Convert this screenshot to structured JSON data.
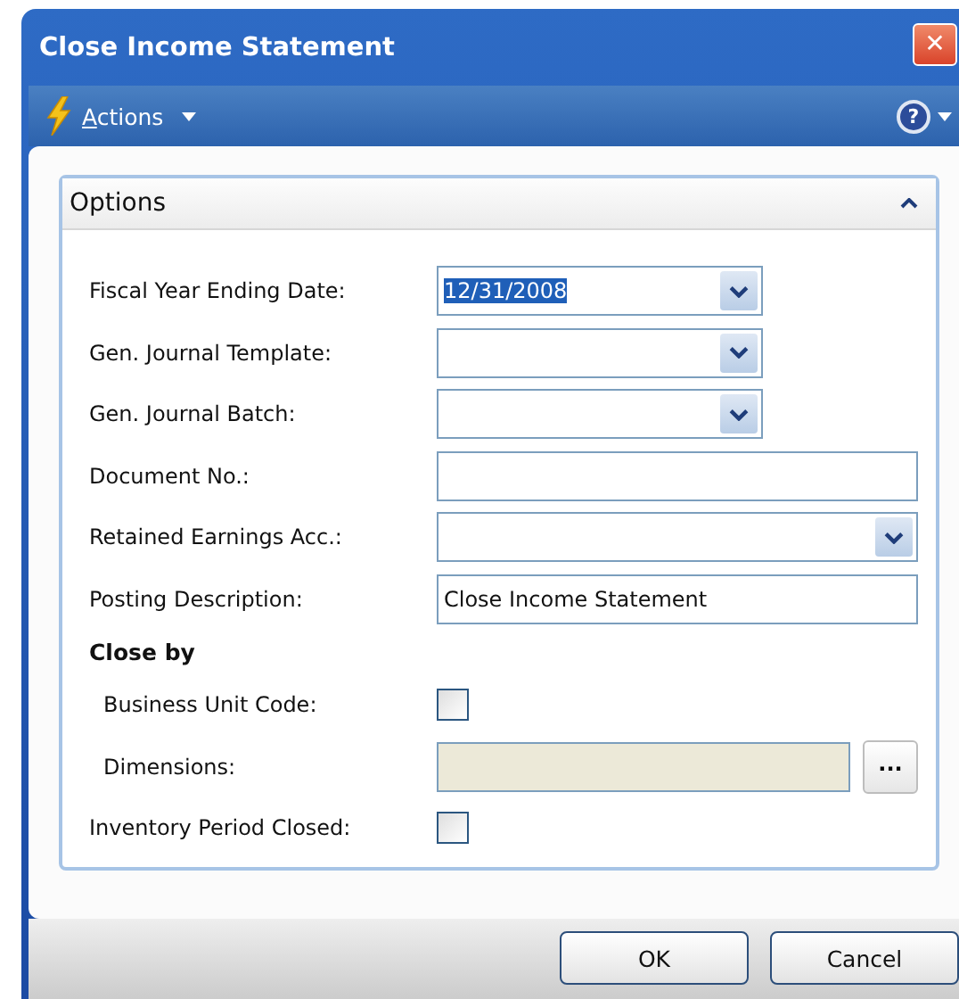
{
  "window": {
    "title": "Close Income Statement",
    "close": "✕"
  },
  "toolbar": {
    "actions": {
      "label": "Actions"
    },
    "help": "?"
  },
  "options": {
    "title": "Options",
    "expanded": true,
    "items": [
      {
        "kind": "dropdown",
        "label": "Fiscal Year Ending Date:",
        "value": "12/31/2008",
        "value_selected": true,
        "wide": false
      },
      {
        "kind": "dropdown",
        "label": "Gen. Journal Template:",
        "wide": false
      },
      {
        "kind": "dropdown",
        "label": "Gen. Journal Batch:",
        "wide": false
      },
      {
        "kind": "text",
        "label": "Document No.:",
        "wide": true
      },
      {
        "kind": "dropdown",
        "label": "Retained Earnings Acc.:",
        "wide": true
      },
      {
        "kind": "text",
        "label": "Posting Description:",
        "value": "Close Income Statement",
        "wide": true
      },
      {
        "kind": "heading",
        "label": "Close by",
        "children": [
          {
            "kind": "checkbox",
            "label": "Business Unit Code:",
            "checked": false
          },
          {
            "kind": "lookup",
            "label": "Dimensions:",
            "disabled": true,
            "button": "..."
          }
        ]
      },
      {
        "kind": "checkbox",
        "label": "Inventory Period Closed:",
        "checked": false
      }
    ]
  },
  "buttons": [
    {
      "label": "OK"
    },
    {
      "label": "Cancel"
    }
  ]
}
